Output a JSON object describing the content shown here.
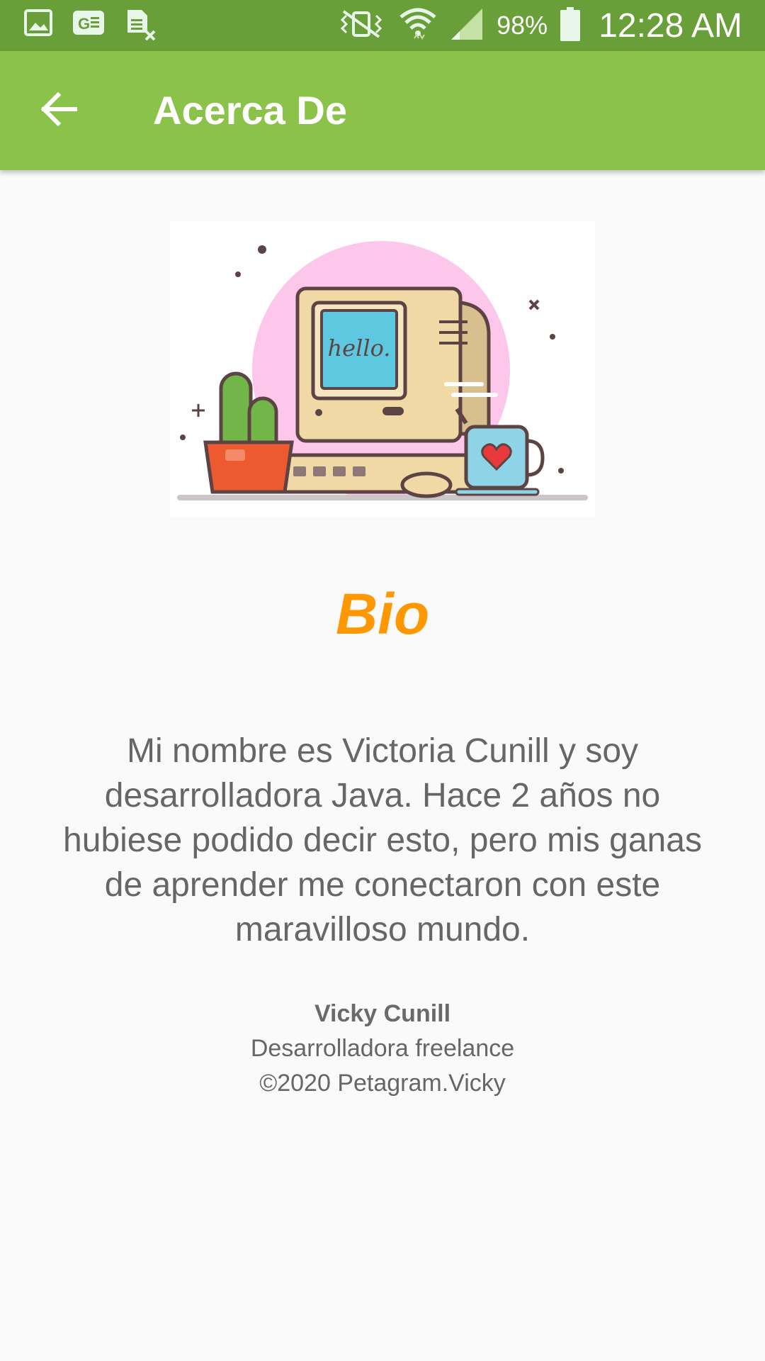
{
  "status_bar": {
    "icons": [
      "gallery-icon",
      "ge-icon",
      "sheet-icon",
      "vibrate-icon",
      "wifi-icon",
      "signal-icon",
      "battery-icon"
    ],
    "battery": "98%",
    "time": "12:28 AM"
  },
  "app_bar": {
    "title": "Acerca De",
    "back_icon": "arrow-back-icon"
  },
  "illustration": {
    "screen_text": "hello."
  },
  "bio": {
    "heading": "Bio",
    "text": "Mi nombre es Victoria Cunill y soy desarrolladora Java. Hace 2 años no hubiese podido decir esto, pero mis ganas de aprender me conectaron con este maravilloso mundo."
  },
  "footer": {
    "author": "Vicky Cunill",
    "role": "Desarrolladora freelance",
    "copyright": "©2020 Petagram.Vicky"
  },
  "colors": {
    "status_bar": "#689f38",
    "app_bar": "#8bc34a",
    "accent": "#ff9800",
    "text": "#666666",
    "background": "#fafafa"
  }
}
